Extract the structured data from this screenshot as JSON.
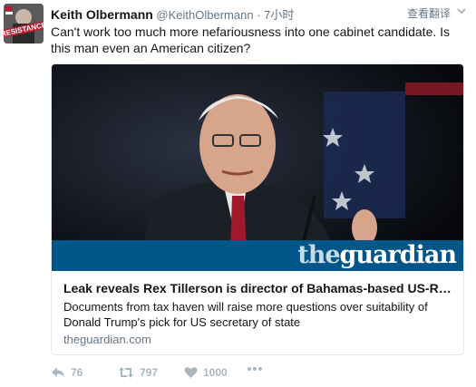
{
  "tweet": {
    "author_name": "Keith Olbermann",
    "author_handle": "@KeithOlbermann",
    "separator": "·",
    "time": "7小时",
    "translate_label": "查看翻译",
    "text": "Can't work too much more nefariousness into one cabinet candidate. Is this man even an American citizen?",
    "avatar_text": "RESISTANCE"
  },
  "card": {
    "publisher_logo_the": "the",
    "publisher_logo_name": "guardian",
    "title": "Leak reveals Rex Tillerson is director of Bahamas-based US-Russian oil firm",
    "description": "Documents from tax haven will raise more questions over suitability of Donald Trump's pick for US secretary of state",
    "domain": "theguardian.com"
  },
  "actions": {
    "reply_count": "76",
    "retweet_count": "797",
    "like_count": "1000"
  },
  "colors": {
    "guardian_blue": "#005689",
    "muted_text": "#657786",
    "icon_gray": "#aab8c2"
  }
}
